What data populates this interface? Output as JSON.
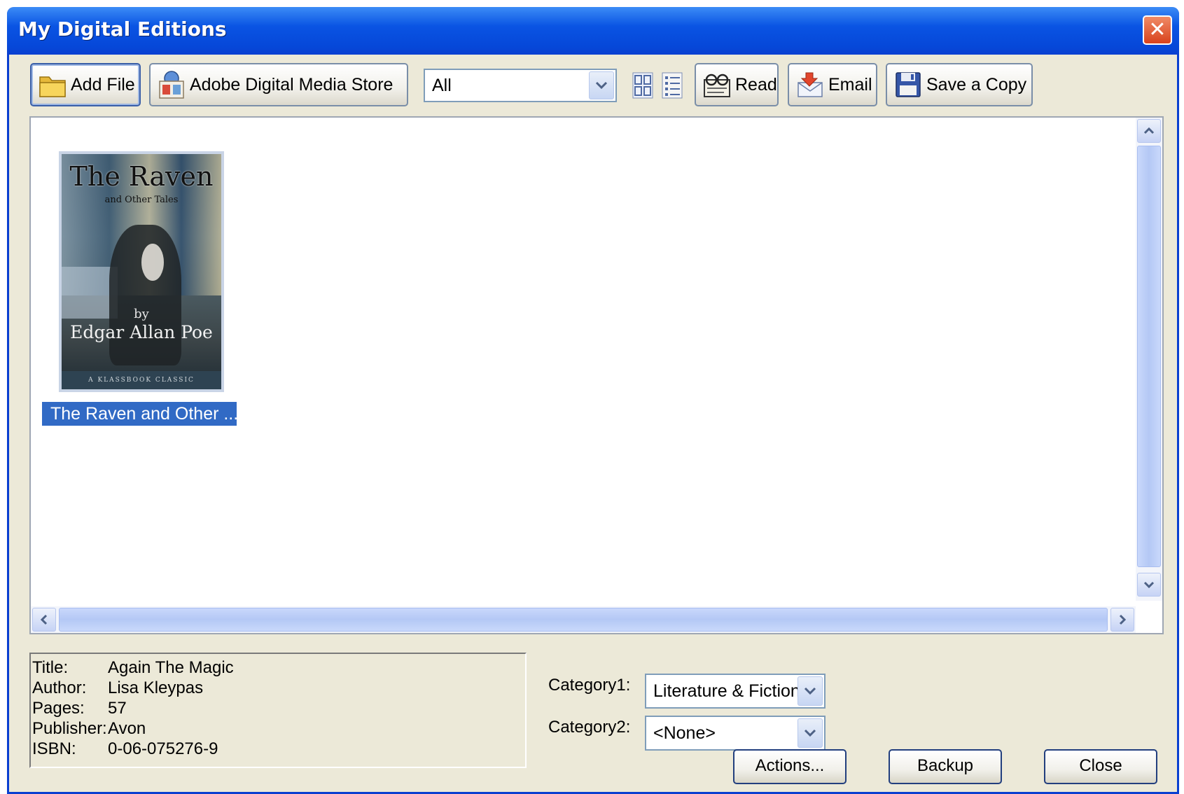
{
  "window": {
    "title": "My Digital Editions",
    "close_label": "✕"
  },
  "toolbar": {
    "add_file": "Add File",
    "store": "Adobe Digital Media Store",
    "filter_value": "All",
    "read": "Read",
    "email": "Email",
    "save_copy": "Save a Copy"
  },
  "library": {
    "books": [
      {
        "label": "The Raven and Other ...",
        "cover_title": "The Raven",
        "cover_subtitle": "and Other Tales",
        "cover_by": "by",
        "cover_author": "Edgar Allan Poe",
        "cover_band": "A KLASSBOOK CLASSIC",
        "selected": true
      }
    ]
  },
  "info": {
    "rows": [
      {
        "key": "Title:",
        "value": "Again The Magic"
      },
      {
        "key": "Author:",
        "value": "Lisa Kleypas"
      },
      {
        "key": "Pages:",
        "value": "57"
      },
      {
        "key": "Publisher:",
        "value": "Avon"
      },
      {
        "key": "ISBN:",
        "value": "0-06-075276-9"
      }
    ]
  },
  "categories": {
    "category1_label": "Category1:",
    "category1_value": "Literature & Fiction",
    "category2_label": "Category2:",
    "category2_value": "<None>"
  },
  "buttons": {
    "actions": "Actions...",
    "backup": "Backup",
    "close": "Close"
  },
  "colors": {
    "titlebar": "#0a54e3",
    "selection": "#316ac5",
    "window_bg": "#ece9d8"
  },
  "icons": [
    "folder-icon",
    "store-icon",
    "chevron-down-icon",
    "thumbnail-view-icon",
    "list-view-icon",
    "read-glasses-icon",
    "email-icon",
    "save-disk-icon"
  ]
}
